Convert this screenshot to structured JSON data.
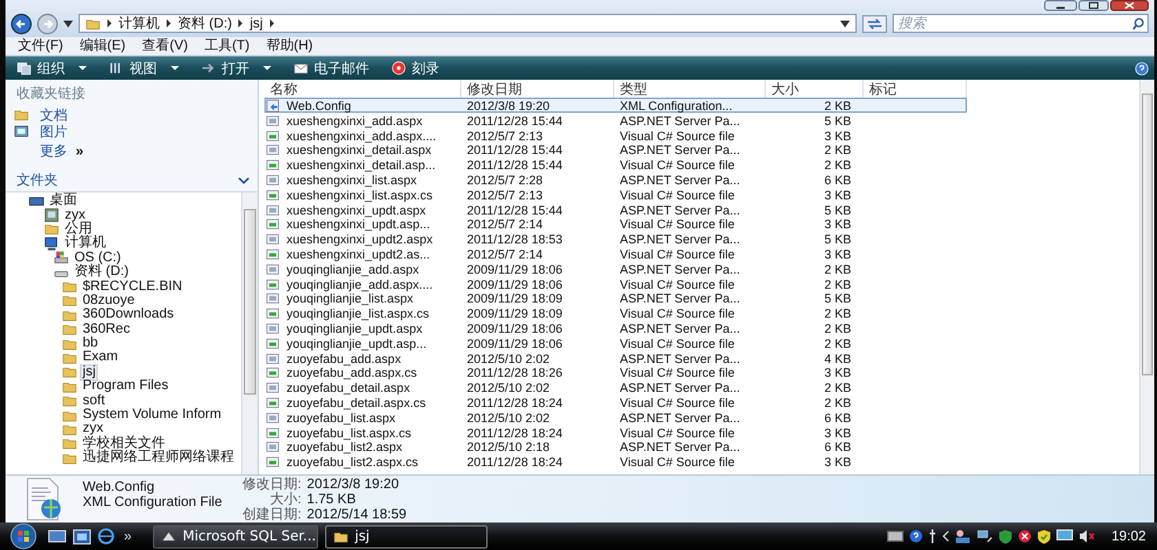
{
  "address_bar": {
    "path": [
      "计算机",
      "资料 (D:)",
      "jsj"
    ],
    "search": {
      "placeholder": "搜索"
    }
  },
  "menu_bar": [
    "文件(F)",
    "编辑(E)",
    "查看(V)",
    "工具(T)",
    "帮助(H)"
  ],
  "toolbar": [
    {
      "label": "组织",
      "kind": "organize",
      "dropdown": true
    },
    {
      "label": "视图",
      "kind": "views",
      "dropdown": true
    },
    {
      "label": "打开",
      "kind": "open",
      "dropdown": true
    },
    {
      "label": "电子邮件",
      "kind": "email",
      "dropdown": false
    },
    {
      "label": "刻录",
      "kind": "burn",
      "dropdown": false
    }
  ],
  "nav_pane": {
    "favorites_title": "收藏夹链接",
    "favorites": [
      {
        "label": "文档",
        "kind": "documents"
      },
      {
        "label": "图片",
        "kind": "pictures"
      }
    ],
    "more": {
      "label": "更多",
      "chevron": "»"
    },
    "folders_title": "文件夹",
    "tree": [
      {
        "label": "桌面",
        "kind": "desktop",
        "selected": false,
        "children": [
          {
            "label": "zyx",
            "kind": "user",
            "selected": false
          },
          {
            "label": "公用",
            "kind": "folder",
            "selected": false
          },
          {
            "label": "计算机",
            "kind": "computer",
            "selected": false,
            "children": [
              {
                "label": "OS (C:)",
                "kind": "system-drive",
                "selected": false
              },
              {
                "label": "资料 (D:)",
                "kind": "drive",
                "selected": false,
                "children": [
                  {
                    "label": "$RECYCLE.BIN",
                    "kind": "folder",
                    "selected": false
                  },
                  {
                    "label": "08zuoye",
                    "kind": "folder",
                    "selected": false
                  },
                  {
                    "label": "360Downloads",
                    "kind": "folder",
                    "selected": false
                  },
                  {
                    "label": "360Rec",
                    "kind": "folder",
                    "selected": false
                  },
                  {
                    "label": "bb",
                    "kind": "folder",
                    "selected": false
                  },
                  {
                    "label": "Exam",
                    "kind": "folder",
                    "selected": false
                  },
                  {
                    "label": "jsj",
                    "kind": "folder",
                    "selected": true
                  },
                  {
                    "label": "Program Files",
                    "kind": "folder",
                    "selected": false
                  },
                  {
                    "label": "soft",
                    "kind": "folder",
                    "selected": false
                  },
                  {
                    "label": "System Volume Inform",
                    "kind": "folder",
                    "selected": false
                  },
                  {
                    "label": "zyx",
                    "kind": "folder",
                    "selected": false
                  },
                  {
                    "label": "学校相关文件",
                    "kind": "folder",
                    "selected": false
                  },
                  {
                    "label": "迅捷网络工程师网络课程",
                    "kind": "folder",
                    "selected": false
                  }
                ]
              }
            ]
          }
        ]
      }
    ]
  },
  "file_list": {
    "columns": [
      "名称",
      "修改日期",
      "类型",
      "大小",
      "标记"
    ],
    "rows": [
      {
        "name": "Web.Config",
        "date": "2012/3/8 19:20",
        "type": "XML Configuration...",
        "size": "2 KB",
        "kind": "config",
        "selected": true
      },
      {
        "name": "xueshengxinxi_add.aspx",
        "date": "2011/12/28 15:44",
        "type": "ASP.NET Server Pa...",
        "size": "5 KB",
        "kind": "aspx",
        "selected": false
      },
      {
        "name": "xueshengxinxi_add.aspx....",
        "date": "2012/5/7 2:13",
        "type": "Visual C# Source file",
        "size": "3 KB",
        "kind": "cs",
        "selected": false
      },
      {
        "name": "xueshengxinxi_detail.aspx",
        "date": "2011/12/28 15:44",
        "type": "ASP.NET Server Pa...",
        "size": "2 KB",
        "kind": "aspx",
        "selected": false
      },
      {
        "name": "xueshengxinxi_detail.asp...",
        "date": "2011/12/28 15:44",
        "type": "Visual C# Source file",
        "size": "2 KB",
        "kind": "cs",
        "selected": false
      },
      {
        "name": "xueshengxinxi_list.aspx",
        "date": "2012/5/7 2:28",
        "type": "ASP.NET Server Pa...",
        "size": "6 KB",
        "kind": "aspx",
        "selected": false
      },
      {
        "name": "xueshengxinxi_list.aspx.cs",
        "date": "2012/5/7 2:13",
        "type": "Visual C# Source file",
        "size": "3 KB",
        "kind": "cs",
        "selected": false
      },
      {
        "name": "xueshengxinxi_updt.aspx",
        "date": "2011/12/28 15:44",
        "type": "ASP.NET Server Pa...",
        "size": "5 KB",
        "kind": "aspx",
        "selected": false
      },
      {
        "name": "xueshengxinxi_updt.asp...",
        "date": "2012/5/7 2:14",
        "type": "Visual C# Source file",
        "size": "3 KB",
        "kind": "cs",
        "selected": false
      },
      {
        "name": "xueshengxinxi_updt2.aspx",
        "date": "2011/12/28 18:53",
        "type": "ASP.NET Server Pa...",
        "size": "5 KB",
        "kind": "aspx",
        "selected": false
      },
      {
        "name": "xueshengxinxi_updt2.as...",
        "date": "2012/5/7 2:14",
        "type": "Visual C# Source file",
        "size": "3 KB",
        "kind": "cs",
        "selected": false
      },
      {
        "name": "youqinglianjie_add.aspx",
        "date": "2009/11/29 18:06",
        "type": "ASP.NET Server Pa...",
        "size": "2 KB",
        "kind": "aspx",
        "selected": false
      },
      {
        "name": "youqinglianjie_add.aspx....",
        "date": "2009/11/29 18:06",
        "type": "Visual C# Source file",
        "size": "2 KB",
        "kind": "cs",
        "selected": false
      },
      {
        "name": "youqinglianjie_list.aspx",
        "date": "2009/11/29 18:09",
        "type": "ASP.NET Server Pa...",
        "size": "5 KB",
        "kind": "aspx",
        "selected": false
      },
      {
        "name": "youqinglianjie_list.aspx.cs",
        "date": "2009/11/29 18:09",
        "type": "Visual C# Source file",
        "size": "2 KB",
        "kind": "cs",
        "selected": false
      },
      {
        "name": "youqinglianjie_updt.aspx",
        "date": "2009/11/29 18:06",
        "type": "ASP.NET Server Pa...",
        "size": "2 KB",
        "kind": "aspx",
        "selected": false
      },
      {
        "name": "youqinglianjie_updt.asp...",
        "date": "2009/11/29 18:06",
        "type": "Visual C# Source file",
        "size": "2 KB",
        "kind": "cs",
        "selected": false
      },
      {
        "name": "zuoyefabu_add.aspx",
        "date": "2012/5/10 2:02",
        "type": "ASP.NET Server Pa...",
        "size": "4 KB",
        "kind": "aspx",
        "selected": false
      },
      {
        "name": "zuoyefabu_add.aspx.cs",
        "date": "2011/12/28 18:26",
        "type": "Visual C# Source file",
        "size": "3 KB",
        "kind": "cs",
        "selected": false
      },
      {
        "name": "zuoyefabu_detail.aspx",
        "date": "2012/5/10 2:02",
        "type": "ASP.NET Server Pa...",
        "size": "2 KB",
        "kind": "aspx",
        "selected": false
      },
      {
        "name": "zuoyefabu_detail.aspx.cs",
        "date": "2011/12/28 18:24",
        "type": "Visual C# Source file",
        "size": "2 KB",
        "kind": "cs",
        "selected": false
      },
      {
        "name": "zuoyefabu_list.aspx",
        "date": "2012/5/10 2:02",
        "type": "ASP.NET Server Pa...",
        "size": "6 KB",
        "kind": "aspx",
        "selected": false
      },
      {
        "name": "zuoyefabu_list.aspx.cs",
        "date": "2011/12/28 18:24",
        "type": "Visual C# Source file",
        "size": "3 KB",
        "kind": "cs",
        "selected": false
      },
      {
        "name": "zuoyefabu_list2.aspx",
        "date": "2012/5/10 2:18",
        "type": "ASP.NET Server Pa...",
        "size": "6 KB",
        "kind": "aspx",
        "selected": false
      },
      {
        "name": "zuoyefabu_list2.aspx.cs",
        "date": "2011/12/28 18:24",
        "type": "Visual C# Source file",
        "size": "3 KB",
        "kind": "cs",
        "selected": false
      }
    ]
  },
  "details_pane": {
    "name": "Web.Config",
    "type": "XML Configuration File",
    "fields": [
      {
        "label": "修改日期:",
        "value": "2012/3/8 19:20"
      },
      {
        "label": "大小:",
        "value": "1.75 KB"
      },
      {
        "label": "创建日期:",
        "value": "2012/5/14 18:59"
      }
    ]
  },
  "taskbar": {
    "quick_launch_more": "»",
    "tasks": [
      {
        "label": "Microsoft SQL Ser...",
        "kind": "sql",
        "selected": false
      },
      {
        "label": "jsj",
        "kind": "folder",
        "selected": true
      }
    ],
    "clock": "19:02"
  }
}
